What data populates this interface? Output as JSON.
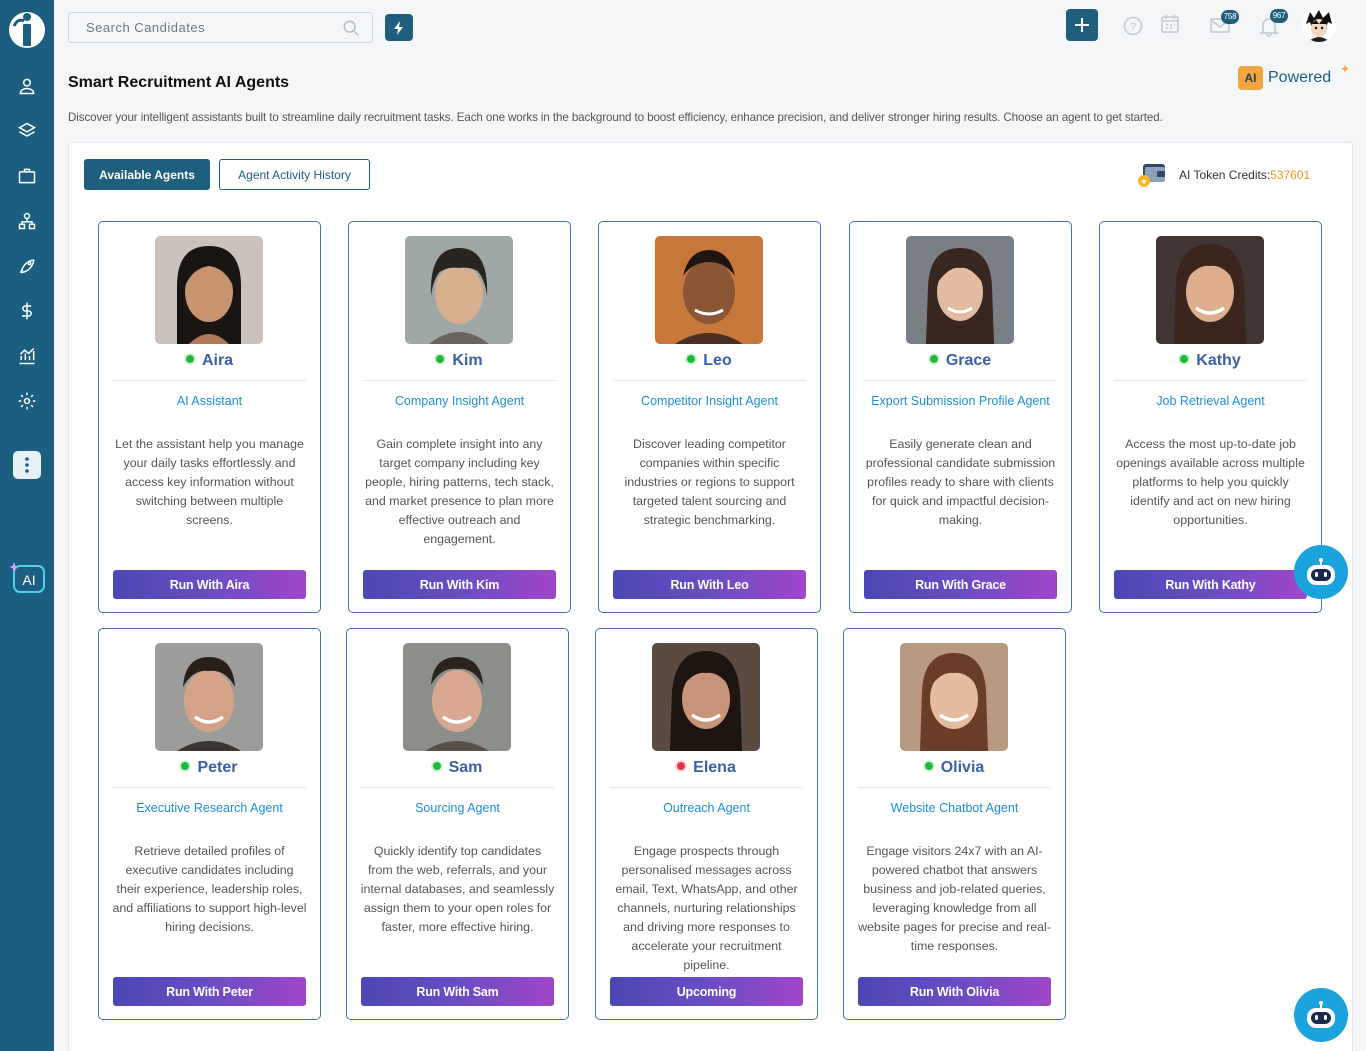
{
  "header": {
    "search_placeholder": "Search Candidates",
    "mail_count": "758",
    "notification_count": "967"
  },
  "page": {
    "title": "Smart Recruitment AI Agents",
    "description": "Discover your intelligent assistants built to streamline daily recruitment tasks. Each one works in the background to boost efficiency, enhance precision, and deliver stronger hiring results. Choose an agent to get started.",
    "ai_chip": "AI",
    "powered_label": "Powered"
  },
  "tabs": {
    "available": "Available Agents",
    "history": "Agent Activity History"
  },
  "credits": {
    "label": "AI Token Credits: ",
    "value": "537601"
  },
  "agents": [
    {
      "name": "Aira",
      "status": "online",
      "role": "AI Assistant",
      "description": "Let the assistant help you manage your daily tasks effortlessly and access key information without switching between multiple screens.",
      "button": "Run With Aira"
    },
    {
      "name": "Kim",
      "status": "online",
      "role": "Company Insight Agent",
      "description": "Gain complete insight into any target company including key people, hiring patterns, tech stack, and market presence to plan more effective outreach and engagement.",
      "button": "Run With Kim"
    },
    {
      "name": "Leo",
      "status": "online",
      "role": "Competitor Insight Agent",
      "description": "Discover leading competitor companies within specific industries or regions to support targeted talent sourcing and strategic benchmarking.",
      "button": "Run With Leo"
    },
    {
      "name": "Grace",
      "status": "online",
      "role": "Export Submission Profile Agent",
      "description": "Easily generate clean and professional candidate submission profiles ready to share with clients for quick and impactful decision-making.",
      "button": "Run With Grace"
    },
    {
      "name": "Kathy",
      "status": "online",
      "role": "Job Retrieval Agent",
      "description": "Access the most up-to-date job openings available across multiple platforms to help you quickly identify and act on new hiring opportunities.",
      "button": "Run With Kathy"
    },
    {
      "name": "Peter",
      "status": "online",
      "role": "Executive Research Agent",
      "description": "Retrieve detailed profiles of executive candidates including their experience, leadership roles, and affiliations to support high-level hiring decisions.",
      "button": "Run With Peter"
    },
    {
      "name": "Sam",
      "status": "online",
      "role": "Sourcing Agent",
      "description": "Quickly identify top candidates from the web, referrals, and your internal databases, and seamlessly assign them to your open roles for faster, more effective hiring.",
      "button": "Run With Sam"
    },
    {
      "name": "Elena",
      "status": "offline",
      "role": "Outreach Agent",
      "description": "Engage prospects through personalised messages across email, Text, WhatsApp, and other channels, nurturing relationships and driving more responses to accelerate your recruitment pipeline.",
      "button": "Upcoming"
    },
    {
      "name": "Olivia",
      "status": "online",
      "role": "Website Chatbot Agent",
      "description": "Engage visitors 24x7 with an AI-powered chatbot that answers business and job-related queries, leveraging knowledge from all website pages for precise and real-time responses.",
      "button": "Run With Olivia"
    }
  ],
  "colors": {
    "sidebar": "#1b5e7f",
    "accent": "#1f5e7c",
    "credits_value": "#f0981e",
    "agent_name": "#3b5fa8",
    "agent_role": "#1e8fd8",
    "online": "#1fba3a",
    "offline": "#e6334a"
  },
  "icons": {
    "sidebar": [
      "user-icon",
      "layers-icon",
      "briefcase-icon",
      "org-chart-icon",
      "rocket-icon",
      "dollar-icon",
      "analytics-icon",
      "gear-icon",
      "more-vertical-icon",
      "ai-sparkle-icon"
    ],
    "header": [
      "search-icon",
      "flash-icon",
      "plus-icon",
      "help-icon",
      "calendar-icon",
      "mail-icon",
      "bell-icon"
    ],
    "floating": "chatbot-icon"
  }
}
